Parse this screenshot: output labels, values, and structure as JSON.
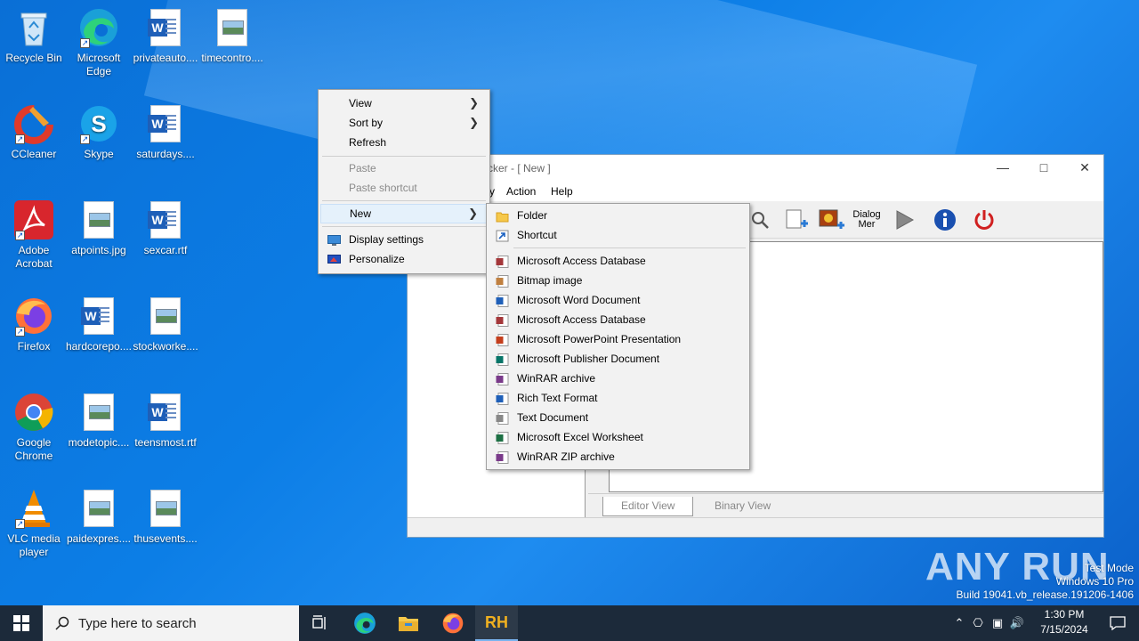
{
  "desktop": {
    "icons": [
      {
        "label": "Recycle Bin",
        "icon": "recycle-bin-icon"
      },
      {
        "label": "Microsoft Edge",
        "icon": "edge-icon"
      },
      {
        "label": "privateauto....",
        "icon": "word-doc-icon"
      },
      {
        "label": "timecontro....",
        "icon": "image-file-icon"
      },
      {
        "label": "CCleaner",
        "icon": "ccleaner-icon"
      },
      {
        "label": "Skype",
        "icon": "skype-icon"
      },
      {
        "label": "saturdays....",
        "icon": "word-doc-icon"
      },
      {
        "label": "Adobe Acrobat",
        "icon": "acrobat-icon"
      },
      {
        "label": "atpoints.jpg",
        "icon": "image-file-icon"
      },
      {
        "label": "sexcar.rtf",
        "icon": "word-doc-icon"
      },
      {
        "label": "Firefox",
        "icon": "firefox-icon"
      },
      {
        "label": "hardcorepo....",
        "icon": "word-doc-icon"
      },
      {
        "label": "stockworke....",
        "icon": "image-file-icon"
      },
      {
        "label": "Google Chrome",
        "icon": "chrome-icon"
      },
      {
        "label": "modetopic....",
        "icon": "image-file-icon"
      },
      {
        "label": "teensmost.rtf",
        "icon": "word-doc-icon"
      },
      {
        "label": "VLC media player",
        "icon": "vlc-icon"
      },
      {
        "label": "paidexpres....",
        "icon": "image-file-icon"
      },
      {
        "label": "thusevents....",
        "icon": "image-file-icon"
      }
    ]
  },
  "app_window": {
    "title": "cker - [ New ]",
    "menu": {
      "partial": "y",
      "action": "Action",
      "help": "Help"
    },
    "toolbar": {
      "dialog_label_1": "Dialog",
      "dialog_label_2": "Mer"
    },
    "tabs": {
      "editor": "Editor View",
      "binary": "Binary View"
    }
  },
  "context_menu": {
    "view": "View",
    "sort_by": "Sort by",
    "refresh": "Refresh",
    "paste": "Paste",
    "paste_shortcut": "Paste shortcut",
    "new": "New",
    "display_settings": "Display settings",
    "personalize": "Personalize"
  },
  "new_submenu": {
    "folder": "Folder",
    "shortcut": "Shortcut",
    "items": [
      {
        "label": "Microsoft Access Database",
        "icon": "access-icon",
        "color": "#a4373a"
      },
      {
        "label": "Bitmap image",
        "icon": "bitmap-icon",
        "color": "#c08040"
      },
      {
        "label": "Microsoft Word Document",
        "icon": "word-icon",
        "color": "#1e5fb8"
      },
      {
        "label": "Microsoft Access Database",
        "icon": "access-icon",
        "color": "#a4373a"
      },
      {
        "label": "Microsoft PowerPoint Presentation",
        "icon": "powerpoint-icon",
        "color": "#c43e1c"
      },
      {
        "label": "Microsoft Publisher Document",
        "icon": "publisher-icon",
        "color": "#077568"
      },
      {
        "label": "WinRAR archive",
        "icon": "winrar-icon",
        "color": "#7a3a8a"
      },
      {
        "label": "Rich Text Format",
        "icon": "word-icon",
        "color": "#1e5fb8"
      },
      {
        "label": "Text Document",
        "icon": "text-doc-icon",
        "color": "#888888"
      },
      {
        "label": "Microsoft Excel Worksheet",
        "icon": "excel-icon",
        "color": "#1d7044"
      },
      {
        "label": "WinRAR ZIP archive",
        "icon": "winrar-icon",
        "color": "#7a3a8a"
      }
    ]
  },
  "taskbar": {
    "search_placeholder": "Type here to search",
    "time": "1:30 PM",
    "date": "7/15/2024"
  },
  "watermark": {
    "line1": "Test Mode",
    "line2": "Windows 10 Pro",
    "line3": "Build 19041.vb_release.191206-1406",
    "brand": "ANY RUN"
  }
}
